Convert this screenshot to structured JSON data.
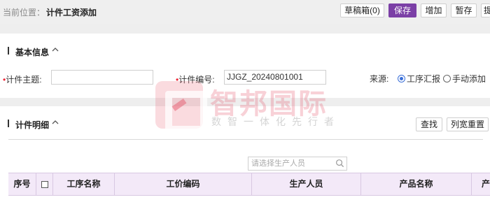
{
  "breadcrumb": {
    "label": "当前位置：",
    "current": "计件工资添加"
  },
  "toolbar": {
    "drafts": "草稿箱(0)",
    "save": "保存",
    "add": "增加",
    "hold": "暂存",
    "more": "提"
  },
  "basic_info": {
    "title": "基本信息",
    "subject_label": "计件主题:",
    "subject_value": "",
    "code_label": "计件编号:",
    "code_value": "JJGZ_20240801001",
    "source_label": "来源:",
    "source_options": [
      "工序汇报",
      "手动添加"
    ],
    "source_selected": "工序汇报"
  },
  "detail": {
    "title": "计件明细",
    "find_button": "查找",
    "reset_width_button": "列宽重置",
    "search_placeholder": "请选择生产人员",
    "columns": [
      "序号",
      "",
      "工序名称",
      "工价编码",
      "生产人员",
      "产品名称",
      "产品"
    ]
  },
  "watermark": {
    "name": "智邦国际",
    "slogan": "数智一体化先行者"
  },
  "colors": {
    "primary": "#7b3fa6",
    "header_bg": "#f3e9f8",
    "required": "#ee2233",
    "radio": "#3a6fd8"
  }
}
